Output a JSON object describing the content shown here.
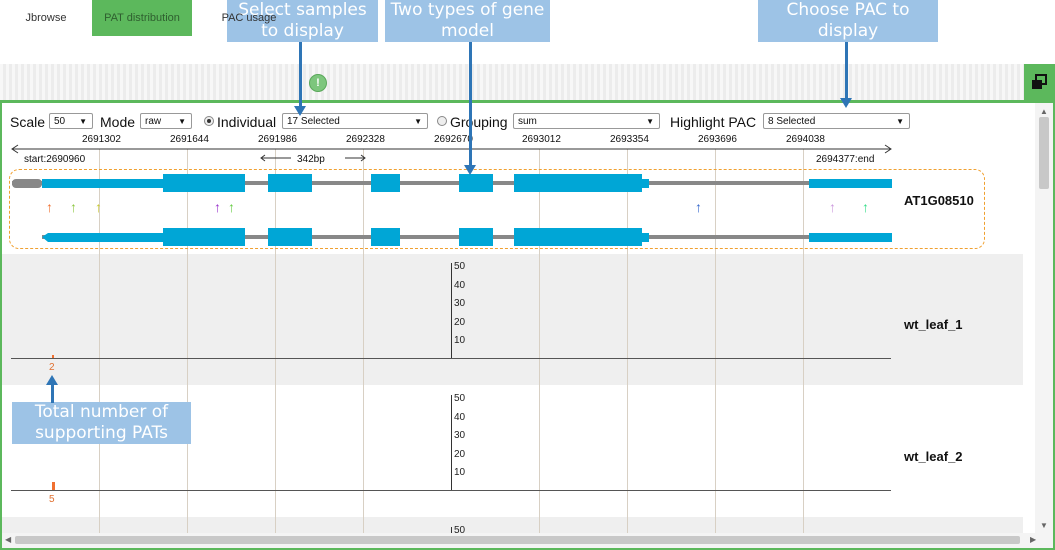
{
  "callouts": {
    "select_samples": [
      "Select samples",
      "to display"
    ],
    "gene_model": [
      "Two types of gene",
      "model"
    ],
    "choose_pac": [
      "Choose PAC to",
      "display"
    ],
    "total_pats": [
      "Total number of",
      "supporting PATs"
    ]
  },
  "tabs": [
    {
      "label": "Jbrowse",
      "active": false
    },
    {
      "label": "PAT distribution",
      "active": true
    },
    {
      "label": "PAC usage",
      "active": false
    }
  ],
  "controls": {
    "scale_label": "Scale",
    "scale_value": "50",
    "mode_label": "Mode",
    "mode_value": "raw",
    "individual_label": "Individual",
    "individual_selected": true,
    "samples_value": "17 Selected",
    "grouping_label": "Grouping",
    "grouping_value": "sum",
    "highlight_label": "Highlight PAC",
    "highlight_value": "8 Selected"
  },
  "ruler": {
    "ticks": [
      "2691302",
      "2691644",
      "2691986",
      "2692328",
      "2692670",
      "2693012",
      "2693354",
      "2693696",
      "2694038"
    ],
    "start": "start:2690960",
    "end": "2694377:end",
    "span": "342bp"
  },
  "gene": {
    "name": "AT1G08510",
    "exon_color": "#00a6d6",
    "pac_arrow_colors": [
      "#f07030",
      "#8cc63f",
      "#c8c832",
      "#9933cc",
      "#66cc44",
      "#3366cc",
      "#cc99dd",
      "#33dd88"
    ]
  },
  "tracks": [
    {
      "name": "wt_leaf_1",
      "y_ticks": [
        "50",
        "40",
        "30",
        "20",
        "10"
      ],
      "count": "2",
      "count_value": 2
    },
    {
      "name": "wt_leaf_2",
      "y_ticks": [
        "50",
        "40",
        "30",
        "20",
        "10"
      ],
      "count": "5",
      "count_value": 5
    },
    {
      "name": "",
      "y_ticks": [
        "50"
      ]
    }
  ]
}
